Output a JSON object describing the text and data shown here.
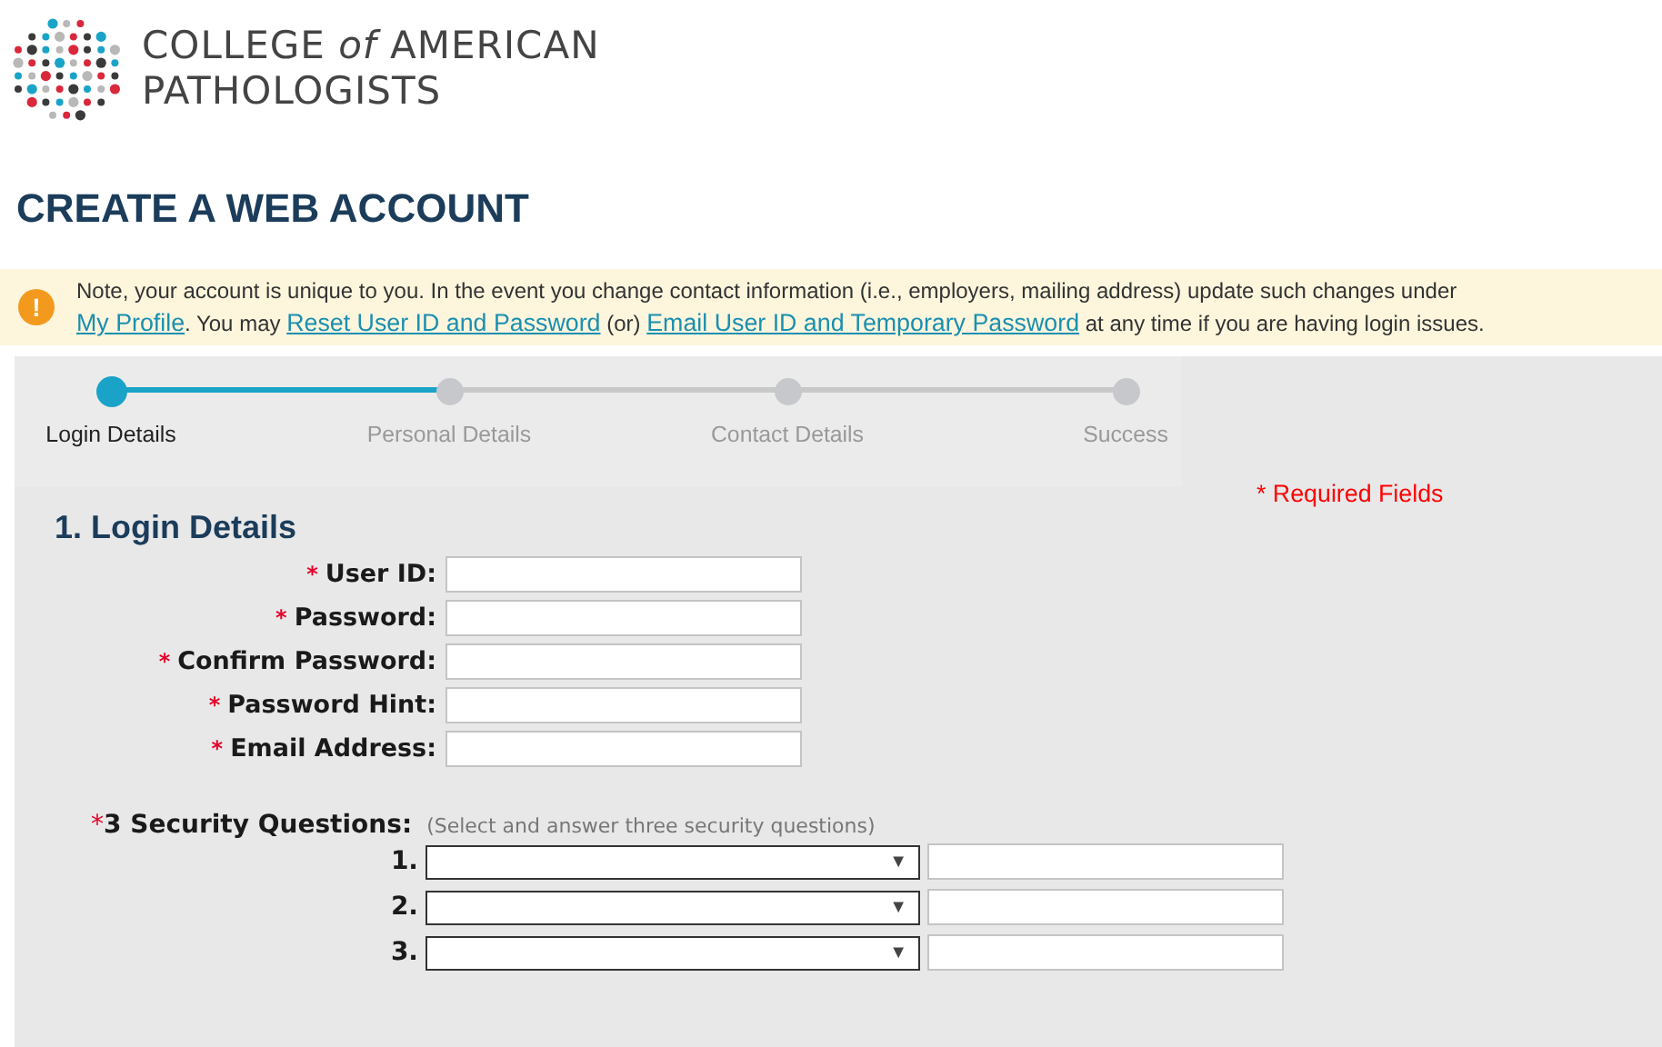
{
  "logo": {
    "line_1": "COLLEGE *of* AMERICAN",
    "line_2": "PATHOLOGISTS"
  },
  "page_title": "CREATE A WEB ACCOUNT",
  "notice": {
    "icon": "!",
    "text_1": "Note, your account is unique to you. In the event you change contact information (i.e., employers, mailing address) update such changes under",
    "link_1": "My Profile",
    "text_2": ". You may",
    "link_2": "Reset User ID and Password",
    "text_3": "(or)",
    "link_3": "Email User ID and Temporary Password",
    "text_4": "at any time if you are having login issues."
  },
  "steps": [
    {
      "label": "Login Details",
      "selected": true
    },
    {
      "label": "Personal Details",
      "selected": false
    },
    {
      "label": "Contact Details",
      "selected": false
    },
    {
      "label": "Success",
      "selected": false
    }
  ],
  "required_note": "* Required Fields",
  "section_title": "1. Login Details",
  "fields": [
    {
      "mark": "*",
      "label": "User ID:"
    },
    {
      "mark": "*",
      "label": "Password:"
    },
    {
      "mark": "*",
      "label": "Confirm Password:"
    },
    {
      "mark": "*",
      "label": "Password Hint:"
    },
    {
      "mark": "*",
      "label": "Email Address:"
    }
  ],
  "security": {
    "mark": "*",
    "label": "3 Security Questions:",
    "hint": "(Select and answer three security questions)",
    "questions": [
      {
        "number": "1.",
        "arrow": "▼"
      },
      {
        "number": "2.",
        "arrow": "▼"
      },
      {
        "number": "3.",
        "arrow": "▼"
      }
    ]
  }
}
